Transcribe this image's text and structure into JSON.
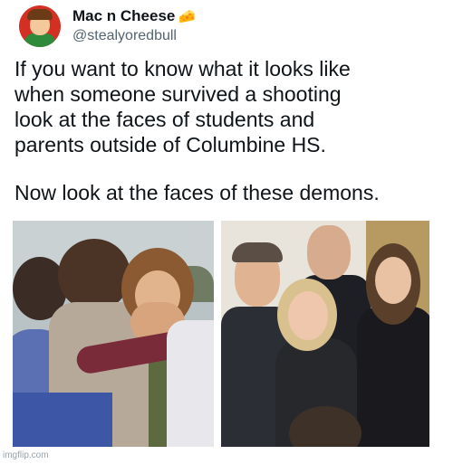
{
  "tweet": {
    "author_name": "Mac n Cheese",
    "author_emoji": "🧀",
    "handle": "@stealyoredbull",
    "text_paragraph_1": "If you want to know what it looks like\nwhen someone survived a shooting\nlook at the faces of students and\nparents outside of Columbine HS.",
    "text_paragraph_2": "Now look at the faces of these demons."
  },
  "media": {
    "left_image": "photo of students hugging and crying",
    "right_image": "photo of smiling group at formal event"
  },
  "watermark": "imgflip.com"
}
